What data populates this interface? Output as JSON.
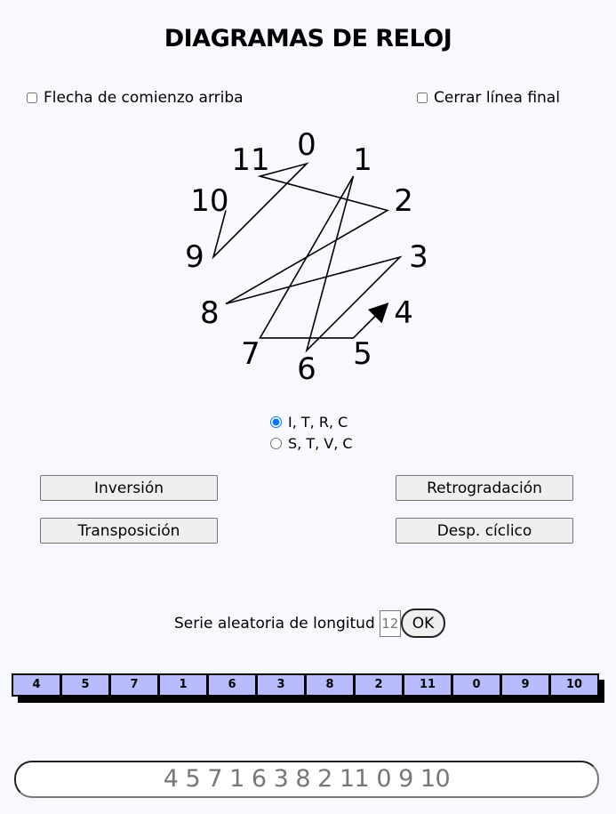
{
  "header": {
    "title": "DIAGRAMAS DE RELOJ"
  },
  "options": {
    "start_arrow_label": "Flecha de comienzo arriba",
    "start_arrow_checked": false,
    "close_line_label": "Cerrar línea final",
    "close_line_checked": false
  },
  "clock": {
    "numbers": [
      "0",
      "1",
      "2",
      "3",
      "4",
      "5",
      "6",
      "7",
      "8",
      "9",
      "10",
      "11"
    ],
    "series": [
      4,
      5,
      7,
      1,
      6,
      3,
      8,
      2,
      11,
      0,
      9,
      10
    ],
    "start_arrow": "arrow-into-first-note"
  },
  "mode": {
    "options": [
      {
        "label": "I, T, R, C",
        "selected": true
      },
      {
        "label": "S, T, V, C",
        "selected": false
      }
    ]
  },
  "buttons": {
    "inversion": "Inversión",
    "retrogradation": "Retrogradación",
    "transposition": "Transposición",
    "cyclic_shift": "Desp. cíclico"
  },
  "random": {
    "label": "Serie aleatoria de longitud",
    "length_placeholder": "12",
    "ok_label": "OK"
  },
  "series_cells": [
    "4",
    "5",
    "7",
    "1",
    "6",
    "3",
    "8",
    "2",
    "11",
    "0",
    "9",
    "10"
  ],
  "series_text": "4 5 7 1 6 3 8 2 11 0 9 10"
}
